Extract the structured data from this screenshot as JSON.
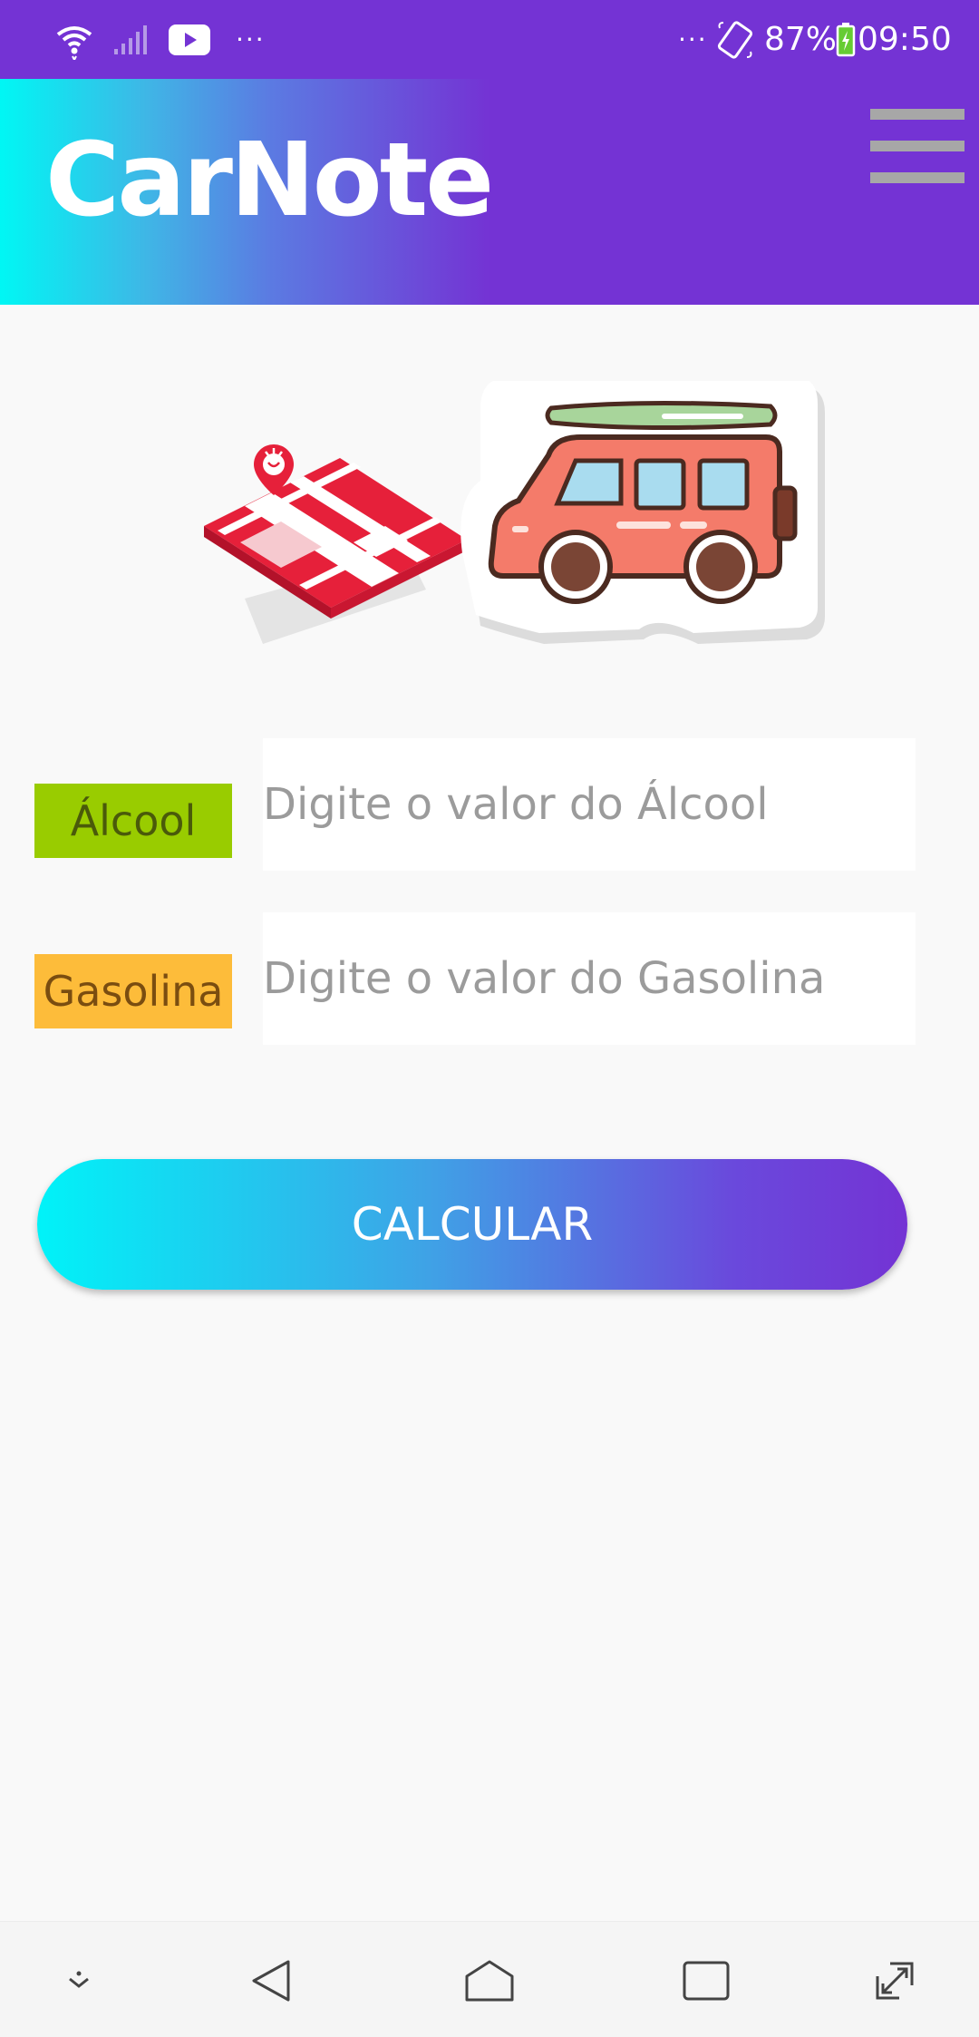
{
  "status_bar": {
    "dots_left": "···",
    "dots_right": "···",
    "battery_percent": "87%",
    "time": "09:50",
    "icons": [
      "wifi-icon",
      "signal-icon",
      "youtube-icon",
      "rotate-icon",
      "battery-charging-icon"
    ]
  },
  "app_bar": {
    "title": "CarNote",
    "menu_icon": "hamburger-menu-icon"
  },
  "illustration": {
    "icons": [
      "city-map-icon",
      "van-icon"
    ]
  },
  "form": {
    "alcool_label": "Álcool",
    "alcool_placeholder": "Digite o valor do Álcool",
    "alcool_value": "",
    "gasolina_label": "Gasolina",
    "gasolina_placeholder": "Digite o valor do Gasolina",
    "gasolina_value": "",
    "calculate_label": "CALCULAR"
  },
  "nav_bar": {
    "icons": [
      "hide-nav-icon",
      "back-icon",
      "home-icon",
      "recents-icon",
      "expand-icon"
    ]
  },
  "colors": {
    "primary": "#7433d4",
    "accent_cyan": "#00f7f4",
    "alcool_tag": "#99cc00",
    "gasolina_tag": "#fdbc3a"
  }
}
